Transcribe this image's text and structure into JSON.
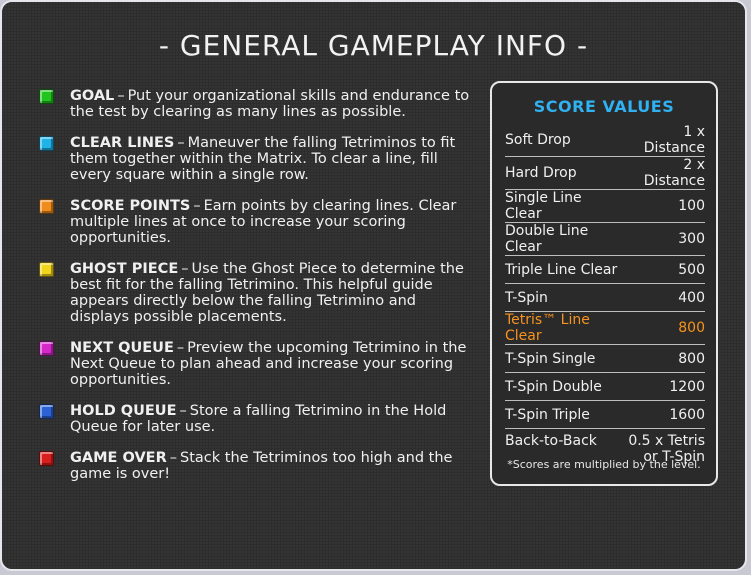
{
  "title": "- GENERAL GAMEPLAY INFO -",
  "colors": {
    "goal": "#22c41e",
    "clear_lines": "#1fb3e8",
    "score_points": "#f08c1c",
    "ghost_piece": "#f0d51c",
    "next_queue": "#d428c9",
    "hold_queue": "#2b63d6",
    "game_over": "#d91e1e",
    "score_title": "#2fb1f2",
    "highlight": "#f7931e"
  },
  "info": [
    {
      "term": "GOAL",
      "desc": "Put your organizational skills and endurance to the test by clearing as many lines as possible.",
      "icon": "green-block-icon"
    },
    {
      "term": "CLEAR LINES",
      "desc": "Maneuver the falling Tetriminos to fit them together within the Matrix. To clear a line, fill every square within a single row.",
      "icon": "cyan-block-icon"
    },
    {
      "term": "SCORE POINTS",
      "desc": "Earn points by clearing lines. Clear multiple lines at once to increase your scoring opportunities.",
      "icon": "orange-block-icon"
    },
    {
      "term": "GHOST PIECE",
      "desc": "Use the Ghost Piece to determine the best fit for the falling Tetrimino. This helpful guide appears directly below the falling Tetrimino and displays possible placements.",
      "icon": "yellow-block-icon"
    },
    {
      "term": "NEXT QUEUE",
      "desc": "Preview the upcoming Tetrimino in the Next Queue to plan ahead and increase your scoring opportunities.",
      "icon": "magenta-block-icon"
    },
    {
      "term": "HOLD QUEUE",
      "desc": "Store a falling Tetrimino in the Hold Queue for later use.",
      "icon": "blue-block-icon"
    },
    {
      "term": "GAME OVER",
      "desc": "Stack the Tetriminos too high and the game is over!",
      "icon": "red-block-icon"
    }
  ],
  "separator": "–",
  "score": {
    "title": "SCORE VALUES",
    "rows": [
      {
        "label": "Soft Drop",
        "value": "1 x Distance"
      },
      {
        "label": "Hard Drop",
        "value": "2 x Distance"
      },
      {
        "label": "Single Line Clear",
        "value": "100"
      },
      {
        "label": "Double Line Clear",
        "value": "300"
      },
      {
        "label": "Triple Line Clear",
        "value": "500"
      },
      {
        "label": "T-Spin",
        "value": "400"
      },
      {
        "label": "Tetris™ Line Clear",
        "value": "800"
      },
      {
        "label": "T-Spin Single",
        "value": "800"
      },
      {
        "label": "T-Spin Double",
        "value": "1200"
      },
      {
        "label": "T-Spin Triple",
        "value": "1600"
      },
      {
        "label": "Back-to-Back",
        "value": "0.5 x Tetris\nor T-Spin"
      }
    ],
    "note": "*Scores are multiplied by the level."
  }
}
